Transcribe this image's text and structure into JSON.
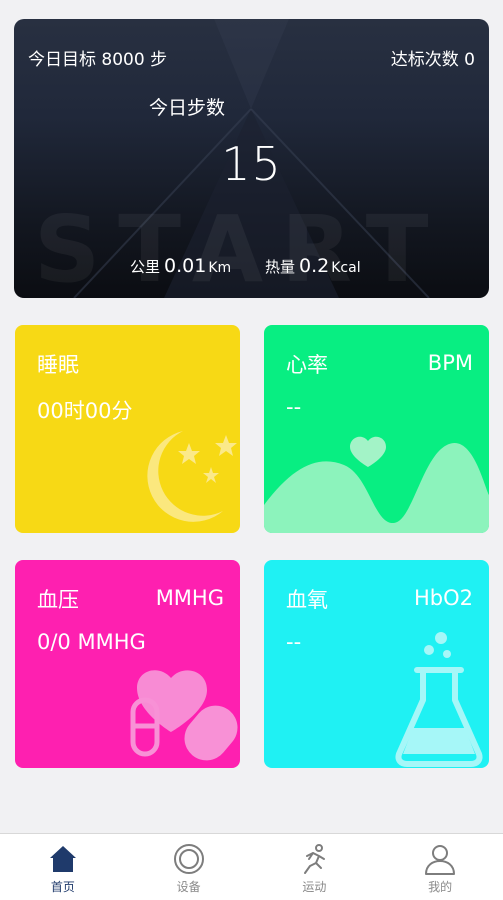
{
  "summary": {
    "goal_text": "今日目标 8000 步",
    "count_text": "达标次数 0",
    "steps_label": "今日步数",
    "steps_value": "15",
    "distance_label": "公里",
    "distance_value": "0.01",
    "distance_unit": "Km",
    "calorie_label": "热量",
    "calorie_value": "0.2",
    "calorie_unit": "Kcal"
  },
  "cards": {
    "sleep": {
      "title": "睡眠",
      "value": "00时00分",
      "color": "#f7d915"
    },
    "heart": {
      "title": "心率",
      "unit": "BPM",
      "value": "--",
      "color": "#08ee82"
    },
    "bp": {
      "title": "血压",
      "unit": "MMHG",
      "value": "0/0 MMHG",
      "color": "#fe20b0"
    },
    "oxy": {
      "title": "血氧",
      "unit": "HbO2",
      "value": "--",
      "color": "#1ff1f3"
    }
  },
  "tabbar": {
    "home": {
      "label": "首页",
      "icon": "home-icon"
    },
    "device": {
      "label": "设备",
      "icon": "device-icon"
    },
    "sport": {
      "label": "运动",
      "icon": "runner-icon"
    },
    "profile": {
      "label": "我的",
      "icon": "user-icon"
    }
  },
  "colors": {
    "active_tab": "#1f3a6b",
    "inactive_tab": "#8a8a8a"
  }
}
